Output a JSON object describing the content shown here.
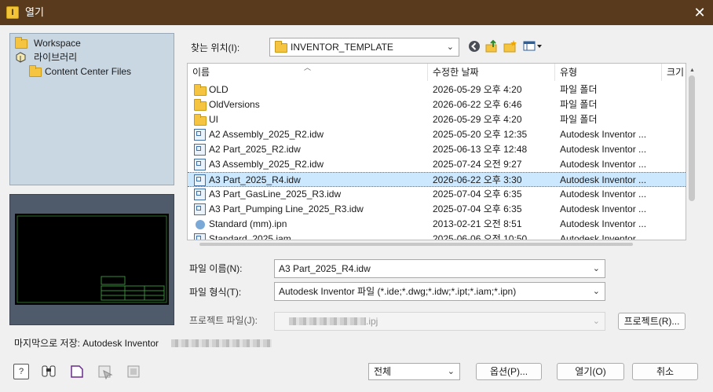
{
  "window": {
    "title": "열기",
    "title_icon": "I",
    "close_glyph": "✕"
  },
  "sidebar": {
    "items": [
      {
        "label": "Workspace",
        "icon": "folder-icon"
      },
      {
        "label": "라이브러리",
        "icon": "library-icon"
      },
      {
        "label": "Content Center Files",
        "icon": "folder-icon"
      }
    ]
  },
  "location": {
    "label": "찾는 위치(I):",
    "value": "INVENTOR_TEMPLATE"
  },
  "toolbar": {
    "back_icon": "back-icon",
    "up_icon": "up-folder-icon",
    "new_folder_icon": "new-folder-icon",
    "view_icon": "view-menu-icon"
  },
  "columns": {
    "name": "이름",
    "modified": "수정한 날짜",
    "type": "유형",
    "size": "크기"
  },
  "files": [
    {
      "name": "OLD",
      "modified": "2026-05-29 오후 4:20",
      "type": "파일 폴더",
      "icon": "folder"
    },
    {
      "name": "OldVersions",
      "modified": "2026-06-22 오후 6:46",
      "type": "파일 폴더",
      "icon": "folder"
    },
    {
      "name": "UI",
      "modified": "2026-05-29 오후 4:20",
      "type": "파일 폴더",
      "icon": "folder"
    },
    {
      "name": "A2 Assembly_2025_R2.idw",
      "modified": "2025-05-20 오후 12:35",
      "type": "Autodesk Inventor ...",
      "icon": "idw"
    },
    {
      "name": "A2 Part_2025_R2.idw",
      "modified": "2025-06-13 오후 12:48",
      "type": "Autodesk Inventor ...",
      "icon": "idw"
    },
    {
      "name": "A3 Assembly_2025_R2.idw",
      "modified": "2025-07-24 오전 9:27",
      "type": "Autodesk Inventor ...",
      "icon": "idw"
    },
    {
      "name": "A3 Part_2025_R4.idw",
      "modified": "2026-06-22 오후 3:30",
      "type": "Autodesk Inventor ...",
      "icon": "idw",
      "selected": true
    },
    {
      "name": "A3 Part_GasLine_2025_R3.idw",
      "modified": "2025-07-04 오후 6:35",
      "type": "Autodesk Inventor ...",
      "icon": "idw"
    },
    {
      "name": "A3 Part_Pumping Line_2025_R3.idw",
      "modified": "2025-07-04 오후 6:35",
      "type": "Autodesk Inventor ...",
      "icon": "idw"
    },
    {
      "name": "Standard (mm).ipn",
      "modified": "2013-02-21 오전 8:51",
      "type": "Autodesk Inventor ...",
      "icon": "ipn"
    },
    {
      "name": "Standard_2025.iam",
      "modified": "2025-06-06 오전 10:50",
      "type": "Autodesk Inventor ...",
      "icon": "iam"
    }
  ],
  "filename": {
    "label": "파일 이름(N):",
    "value": "A3 Part_2025_R4.idw"
  },
  "filetype": {
    "label": "파일 형식(T):",
    "value": "Autodesk Inventor 파일 (*.ide;*.dwg;*.idw;*.ipt;*.iam;*.ipn)"
  },
  "project": {
    "label": "프로젝트 파일(J):",
    "value": ".ipj",
    "button": "프로젝트(R)..."
  },
  "last_saved": {
    "label": "마지막으로 저장: Autodesk Inventor"
  },
  "footer": {
    "scope": "전체",
    "options_button": "옵션(P)...",
    "open_button": "열기(O)",
    "cancel_button": "취소"
  },
  "colors": {
    "titlebar": "#5a3a1c",
    "selection": "#cce8ff",
    "sidebar": "#c9d7e3"
  }
}
